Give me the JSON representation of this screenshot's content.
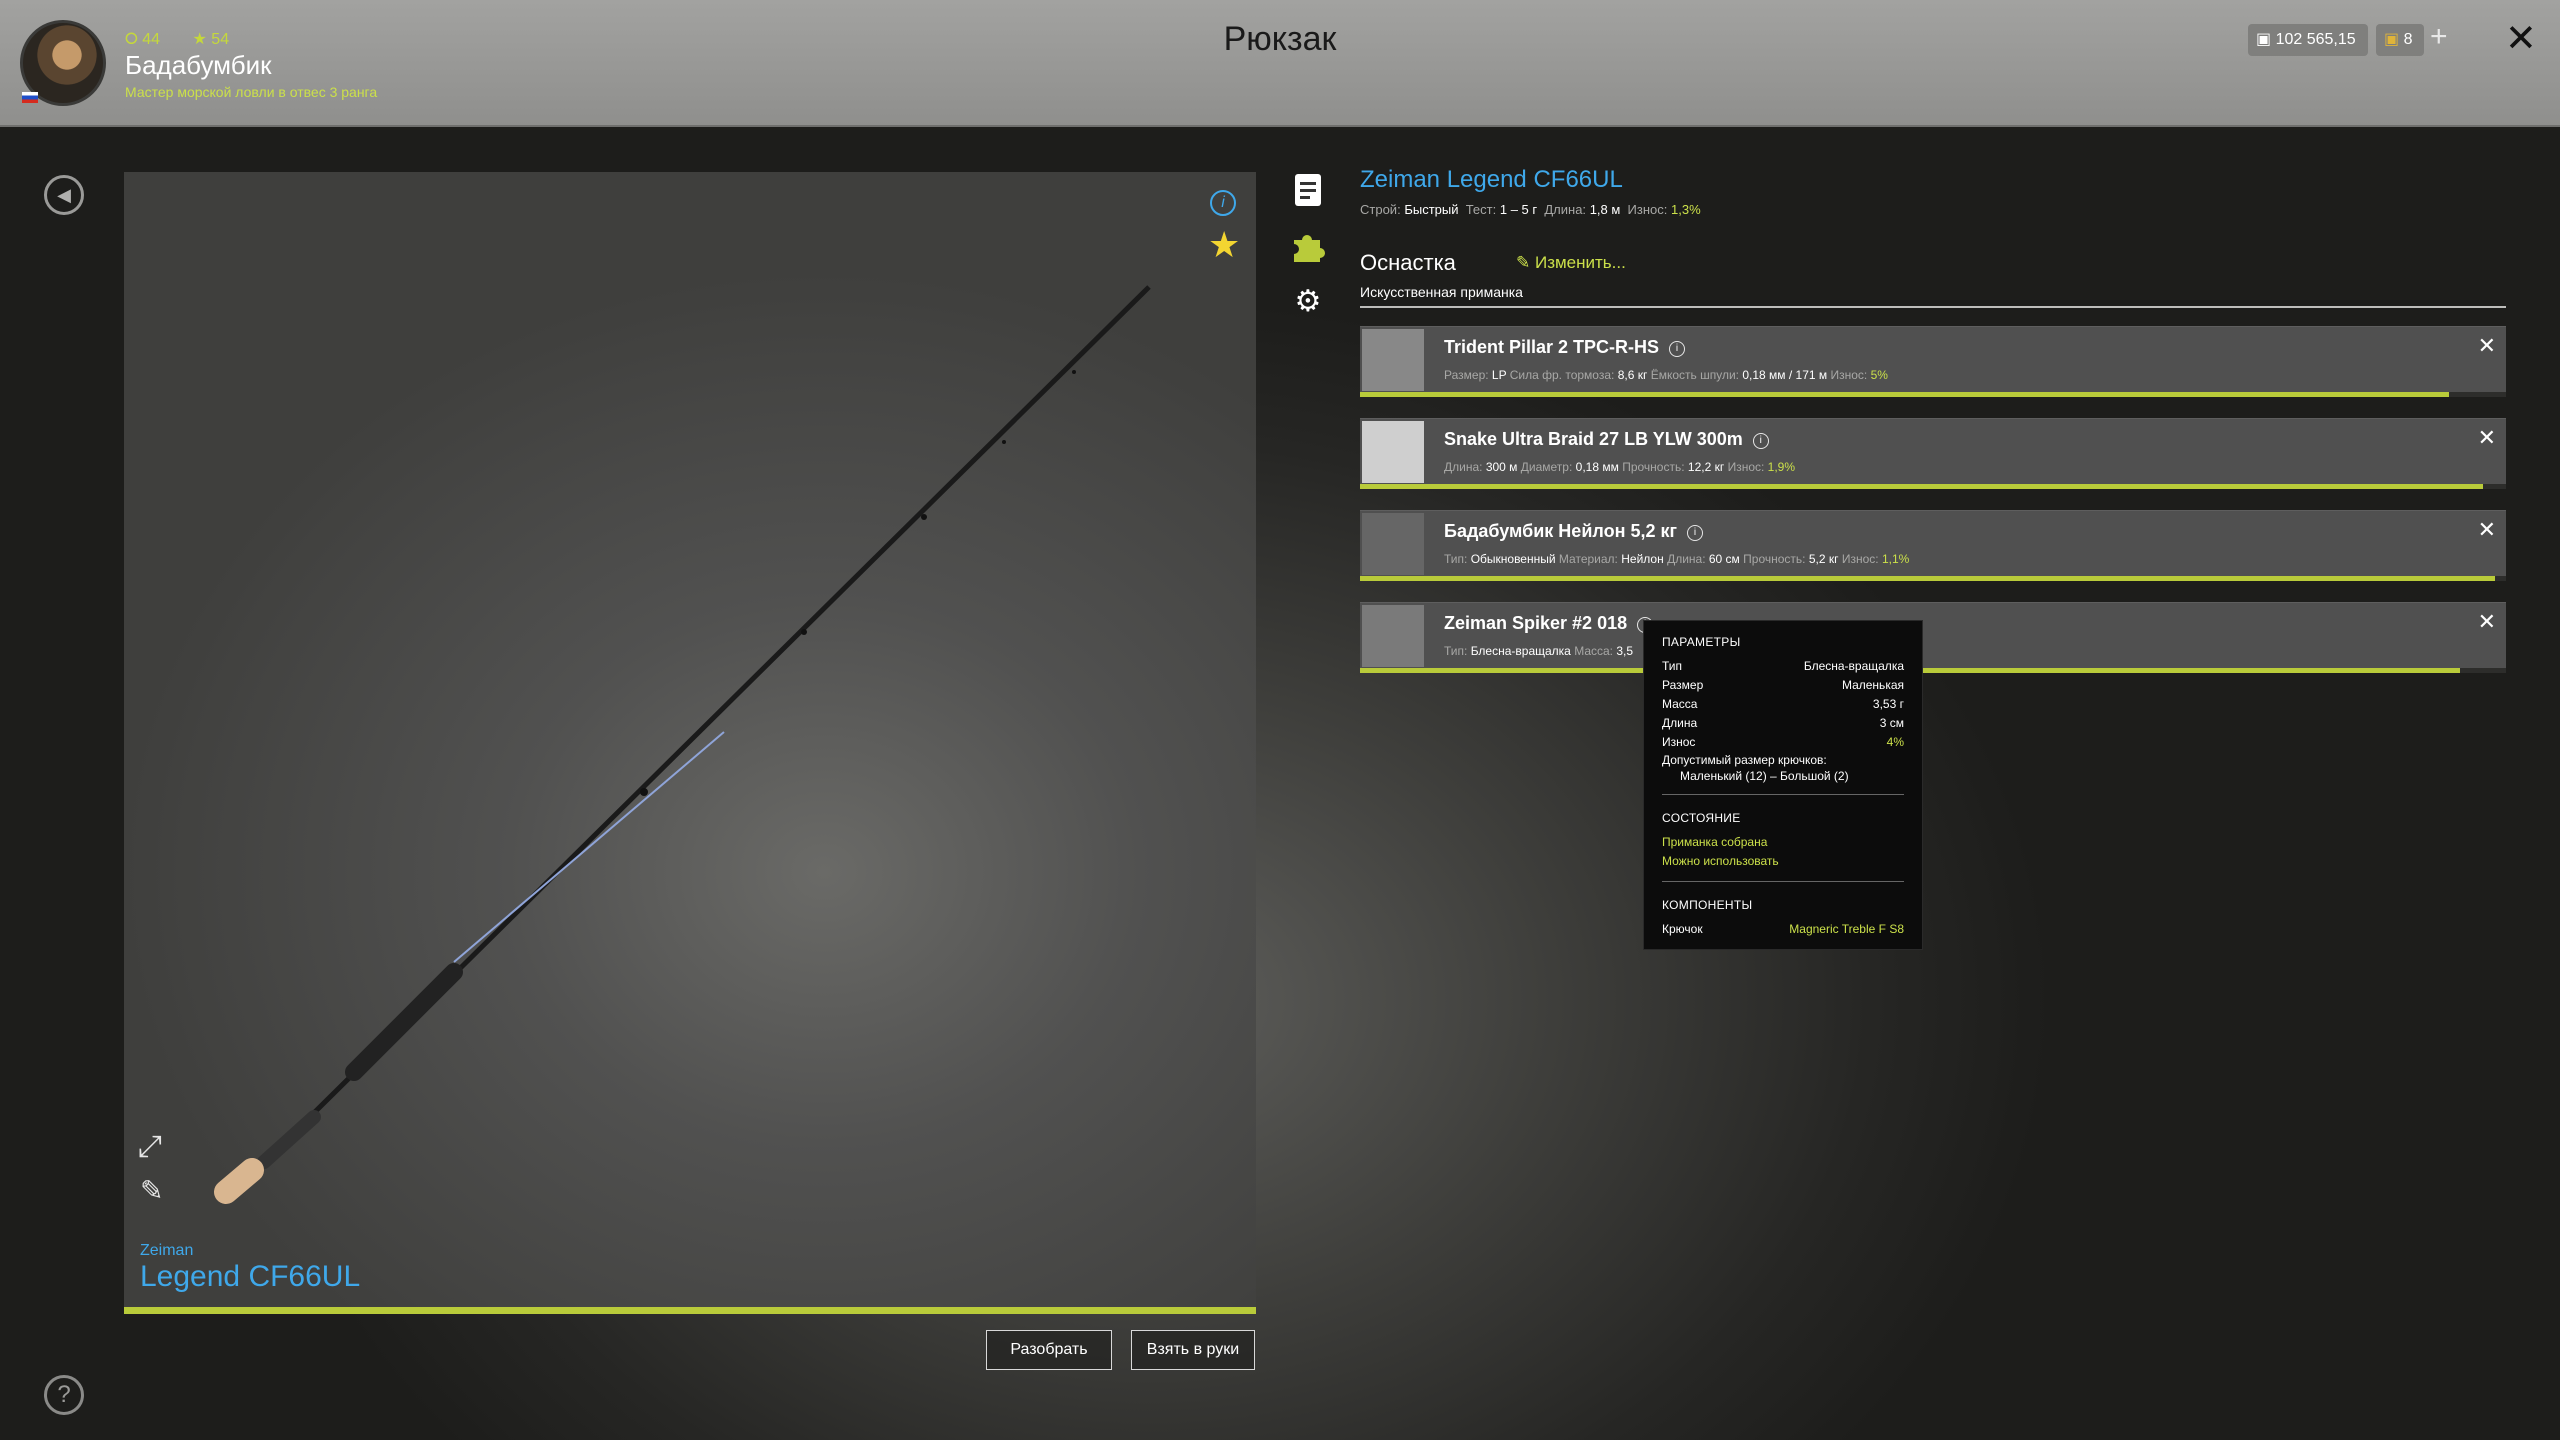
{
  "header": {
    "title": "Рюкзак",
    "player": {
      "name": "Бадабумбик",
      "rank_text": "Мастер морской ловли в отвес 3 ранга",
      "level": "44",
      "stars": "54"
    },
    "currency": {
      "silver": "102 565,15",
      "gold": "8"
    }
  },
  "viewer": {
    "brand": "Zeiman",
    "model": "Legend CF66UL",
    "condition_fraction": 1.0
  },
  "buttons": {
    "disassemble": "Разобрать",
    "equip": "Взять в руки"
  },
  "rod": {
    "name": "Zeiman Legend CF66UL",
    "stats": {
      "action_label": "Строй:",
      "action": "Быстрый",
      "test_label": "Тест:",
      "test": "1 – 5 г",
      "length_label": "Длина:",
      "length": "1,8 м",
      "wear_label": "Износ:",
      "wear": "1,3%"
    }
  },
  "tackle": {
    "title": "Оснастка",
    "edit_label": "Изменить...",
    "subtitle": "Искусственная приманка"
  },
  "slots": [
    {
      "name": "Trident Pillar 2 TPC-R-HS",
      "meta": [
        [
          "Размер:",
          "LP"
        ],
        [
          "Сила фр. тормоза:",
          "8,6 кг"
        ],
        [
          "Ёмкость шпули:",
          "0,18 мм / 171 м"
        ],
        [
          "Износ:",
          "5%"
        ]
      ],
      "condition_fraction": 0.95
    },
    {
      "name": "Snake Ultra Braid 27 LB YLW 300m",
      "meta": [
        [
          "Длина:",
          "300 м"
        ],
        [
          "Диаметр:",
          "0,18 мм"
        ],
        [
          "Прочность:",
          "12,2 кг"
        ],
        [
          "Износ:",
          "1,9%"
        ]
      ],
      "condition_fraction": 0.98
    },
    {
      "name": "Бадабумбик Нейлон 5,2 кг",
      "meta": [
        [
          "Тип:",
          "Обыкновенный"
        ],
        [
          "Материал:",
          "Нейлон"
        ],
        [
          "Длина:",
          "60 см"
        ],
        [
          "Прочность:",
          "5,2 кг"
        ],
        [
          "Износ:",
          "1,1%"
        ]
      ],
      "condition_fraction": 0.99
    },
    {
      "name": "Zeiman Spiker #2 018",
      "meta": [
        [
          "Тип:",
          "Блесна-вращалка"
        ],
        [
          "Масса:",
          "3,5"
        ]
      ],
      "condition_fraction": 0.96
    }
  ],
  "tooltip": {
    "params_title": "ПАРАМЕТРЫ",
    "params": [
      [
        "Тип",
        "Блесна-вращалка"
      ],
      [
        "Размер",
        "Маленькая"
      ],
      [
        "Масса",
        "3,53 г"
      ],
      [
        "Длина",
        "3 см"
      ],
      [
        "Износ",
        "4%"
      ]
    ],
    "hook_size_label": "Допустимый размер крючков:",
    "hook_size_value": "Маленький (12) – Большой (2)",
    "state_title": "СОСТОЯНИЕ",
    "state_lines": [
      "Приманка собрана",
      "Можно использовать"
    ],
    "components_title": "КОМПОНЕНТЫ",
    "component_label": "Крючок",
    "component_value": "Magneric Treble F S8"
  },
  "icons": {
    "back": "back-icon",
    "help": "help-icon",
    "info": "info-icon",
    "favorite": "star-icon",
    "expand": "expand-icon",
    "paint": "brush-icon",
    "description": "document-icon",
    "tackle": "puzzle-icon",
    "settings": "gear-icon"
  },
  "colors": {
    "accent_blue": "#3fa8ea",
    "accent_green": "#cbe04a",
    "bar_green": "#b9cb3a"
  }
}
